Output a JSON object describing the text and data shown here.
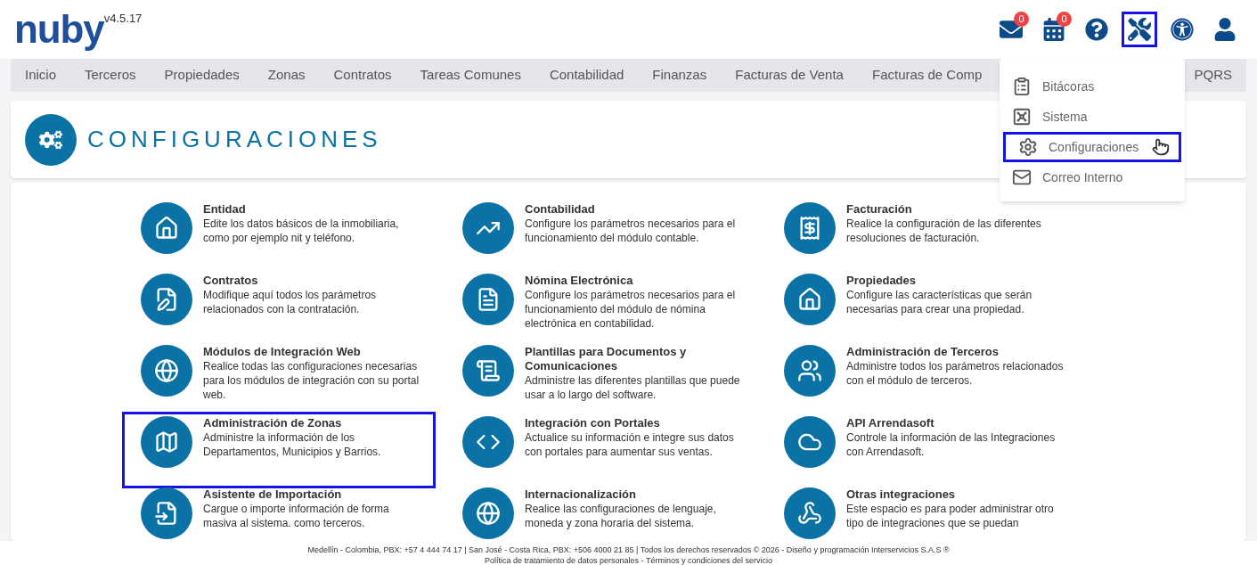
{
  "header": {
    "logo": "nuby",
    "version": "v4.5.17",
    "actions": [
      {
        "badge": "0",
        "highlighted": false
      },
      {
        "badge": "0",
        "highlighted": false
      },
      {
        "highlighted": false
      },
      {
        "highlighted": true
      },
      {
        "highlighted": false
      },
      {
        "highlighted": false
      }
    ]
  },
  "nav": {
    "items": [
      "Inicio",
      "Terceros",
      "Propiedades",
      "Zonas",
      "Contratos",
      "Tareas Comunes",
      "Contabilidad",
      "Finanzas",
      "Facturas de Venta",
      "Facturas de Comp"
    ],
    "end_item": "PQRS"
  },
  "dropdown": {
    "items": [
      {
        "label": "Bitácoras",
        "highlighted": false
      },
      {
        "label": "Sistema",
        "highlighted": false
      },
      {
        "label": "Configuraciones",
        "highlighted": true
      },
      {
        "label": "Correo Interno",
        "highlighted": false
      }
    ]
  },
  "page_title": "CONFIGURACIONES",
  "modules": [
    {
      "title": "Entidad",
      "description": "Edite los datos básicos de la inmobiliaria, como por ejemplo nit y teléfono.",
      "highlighted": false
    },
    {
      "title": "Contabilidad",
      "description": "Configure los parámetros necesarios para el funcionamiento del módulo contable.",
      "highlighted": false
    },
    {
      "title": "Facturación",
      "description": "Realice la configuración de las diferentes resoluciones de facturación.",
      "highlighted": false
    },
    {
      "title": "Contratos",
      "description": "Modifique aquí todos los parámetros relacionados con la contratación.",
      "highlighted": false
    },
    {
      "title": "Nómina Electrónica",
      "description": "Configure los parámetros necesarios para el funcionamiento del módulo de nómina electrónica en contabilidad.",
      "highlighted": false
    },
    {
      "title": "Propiedades",
      "description": "Configure las características que serán necesarias para crear una propiedad.",
      "highlighted": false
    },
    {
      "title": "Módulos de Integración Web",
      "description": "Realice todas las configuraciones necesarias para los módulos de integración con su portal web.",
      "highlighted": false
    },
    {
      "title": "Plantillas para Documentos y Comunicaciones",
      "description": "Administre las diferentes plantillas que puede usar a lo largo del software.",
      "highlighted": false
    },
    {
      "title": "Administración de Terceros",
      "description": "Administre todos los parámetros relacionados con el módulo de terceros.",
      "highlighted": false
    },
    {
      "title": "Administración de Zonas",
      "description": "Administre la información de los Departamentos, Municipios y Barrios.",
      "highlighted": true
    },
    {
      "title": "Integración con Portales",
      "description": "Actualice su información e integre sus datos con portales para aumentar sus ventas.",
      "highlighted": false
    },
    {
      "title": "API Arrendasoft",
      "description": "Controle la información de las Integraciones con Arrendasoft.",
      "highlighted": false
    },
    {
      "title": "Asistente de Importación",
      "description": "Cargue o importe información de forma masiva al sistema. como terceros.",
      "highlighted": false
    },
    {
      "title": "Internacionalización",
      "description": "Realice las configuraciones de lenguaje, moneda y zona horaria del sistema.",
      "highlighted": false
    },
    {
      "title": "Otras integraciones",
      "description": "Este espacio es para poder administrar otro tipo de integraciones que se puedan",
      "highlighted": false
    }
  ],
  "footer": {
    "line": "Medellín - Colombia, PBX: +57 4 444 74 17 | San José - Costa Rica, PBX: +506 4000 21 85 | Todos los derechos reservados © 2026 - Diseño y programación Interservicios S.A.S ®",
    "links": "Política de tratamiento de datos personales - Términos y condiciones del servicio"
  }
}
